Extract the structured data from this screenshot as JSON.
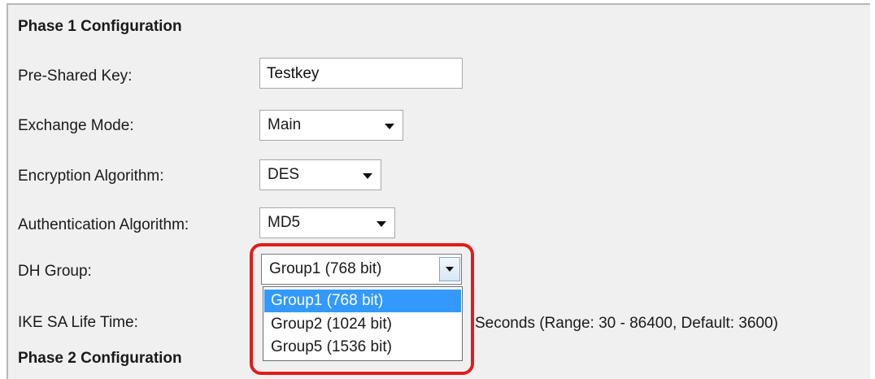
{
  "phase1": {
    "title": "Phase 1 Configuration",
    "pre_shared_key": {
      "label": "Pre-Shared Key:",
      "value": "Testkey"
    },
    "exchange_mode": {
      "label": "Exchange Mode:",
      "value": "Main"
    },
    "encryption_algorithm": {
      "label": "Encryption Algorithm:",
      "value": "DES"
    },
    "authentication_algorithm": {
      "label": "Authentication Algorithm:",
      "value": "MD5"
    },
    "dh_group": {
      "label": "DH Group:",
      "value": "Group1 (768 bit)",
      "options": [
        "Group1 (768 bit)",
        "Group2 (1024 bit)",
        "Group5 (1536 bit)"
      ],
      "highlighted_option": "Group1 (768 bit)"
    },
    "ike_sa_life_time": {
      "label": "IKE SA Life Time:",
      "suffix": "Seconds  (Range: 30 - 86400, Default: 3600)"
    }
  },
  "phase2": {
    "title": "Phase 2 Configuration"
  },
  "colors": {
    "panel_bg": "#f0f0f0",
    "selected_option": "#3399ff",
    "highlight_ring": "#e31b1b"
  }
}
